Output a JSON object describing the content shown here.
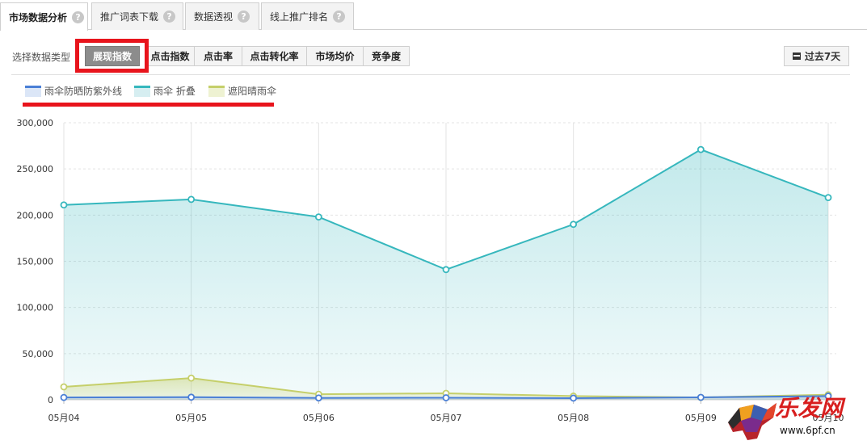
{
  "tabs": [
    {
      "label": "市场数据分析",
      "active": true
    },
    {
      "label": "推广词表下载",
      "active": false
    },
    {
      "label": "数据透视",
      "active": false
    },
    {
      "label": "线上推广排名",
      "active": false
    }
  ],
  "help_symbol": "?",
  "toolbar": {
    "type_label": "选择数据类型",
    "buttons": [
      "展现指数",
      "点击指数",
      "点击率",
      "点击转化率",
      "市场均价",
      "竞争度"
    ],
    "selected_index": 0,
    "range_label": "过去7天"
  },
  "colors": {
    "accent_red": "#e8141c",
    "series_blue": "#4a7fd6",
    "series_teal": "#36b7bd",
    "series_olive": "#c5cf6a"
  },
  "chart_data": {
    "type": "area",
    "categories": [
      "05月04",
      "05月05",
      "05月06",
      "05月07",
      "05月08",
      "05月09",
      "05月10"
    ],
    "series": [
      {
        "name": "雨伞防晒防紫外线",
        "color": "#4a7fd6",
        "values": [
          2500,
          2800,
          2000,
          2200,
          1800,
          2600,
          4000
        ]
      },
      {
        "name": "雨伞 折叠",
        "color": "#36b7bd",
        "values": [
          211000,
          217000,
          198000,
          141000,
          190000,
          271000,
          219000
        ]
      },
      {
        "name": "遮阳晴雨伞",
        "color": "#c5cf6a",
        "values": [
          14000,
          23500,
          6000,
          7000,
          4000,
          2500,
          5500
        ]
      }
    ],
    "y_ticks": [
      "0",
      "50,000",
      "100,000",
      "150,000",
      "200,000",
      "250,000",
      "300,000"
    ],
    "ylim": [
      0,
      300000
    ],
    "grid": true,
    "legend_position": "top-left"
  },
  "watermark": {
    "text": "乐发网",
    "url": "www.6pf.cn"
  }
}
